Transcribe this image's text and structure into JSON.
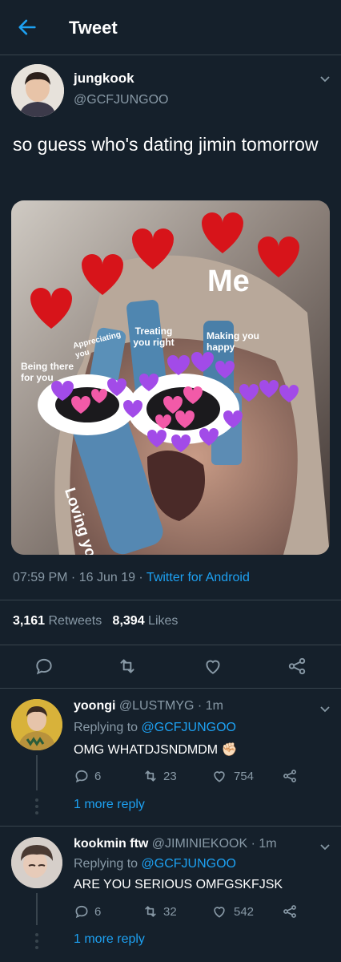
{
  "header": {
    "title": "Tweet"
  },
  "tweet": {
    "name": "jungkook",
    "handle": "@GCFJUNGOO",
    "text": "so guess who's dating jimin tomorrow",
    "time": "07:59 PM",
    "date": "16 Jun 19",
    "app": "Twitter for Android",
    "retweets": "3,161",
    "retweets_label": "Retweets",
    "likes": "8,394",
    "likes_label": "Likes",
    "media_labels": {
      "me": "Me",
      "treating": "Treating you right",
      "making": "Making you happy",
      "appreciating": "Appreciating you",
      "being": "Being there for you",
      "loving": "Loving you"
    }
  },
  "replies": [
    {
      "name": "yoongi",
      "handle": "@LUSTMYG",
      "time": "1m",
      "replying_prefix": "Replying to",
      "replying_to": "@GCFJUNGOO",
      "text": "OMG WHATDJSNDMDM ✊🏻",
      "comments": "6",
      "retweets": "23",
      "likes": "754",
      "more": "1 more reply"
    },
    {
      "name": "kookmin ftw",
      "handle": "@JIMINIEKOOK",
      "time": "1m",
      "replying_prefix": "Replying to",
      "replying_to": "@GCFJUNGOO",
      "text": "ARE YOU SERIOUS OMFGSKFJSK",
      "comments": "6",
      "retweets": "32",
      "likes": "542",
      "more": "1 more reply"
    }
  ],
  "colors": {
    "bg": "#15202b",
    "accent": "#1da1f2",
    "muted": "#8899a6",
    "border": "#38444d"
  }
}
